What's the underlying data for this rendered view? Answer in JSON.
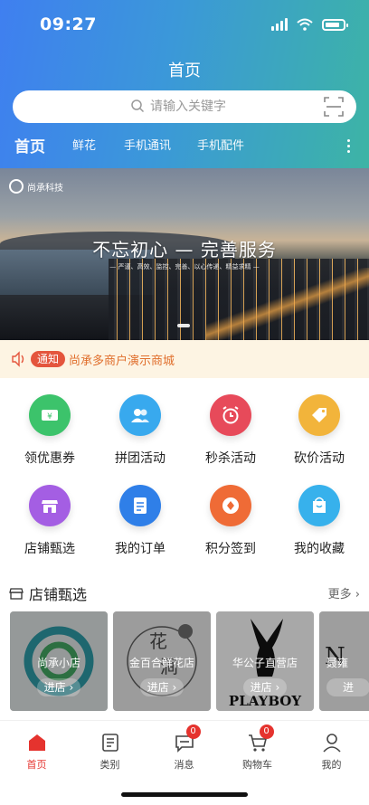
{
  "status_bar": {
    "time": "09:27"
  },
  "header": {
    "title": "首页"
  },
  "search": {
    "placeholder": "请输入关键字",
    "icon": "search-icon",
    "scan_icon": "scan-icon"
  },
  "category_tabs": [
    {
      "label": "首页",
      "active": true
    },
    {
      "label": "鲜花"
    },
    {
      "label": "手机通讯"
    },
    {
      "label": "手机配件"
    }
  ],
  "banner": {
    "logo_text": "尚承科技",
    "headline": "不忘初心 — 完善服务",
    "tagline": "— 严谨、高效、监控、完善、以心传递、精益求精 —"
  },
  "notice": {
    "badge": "通知",
    "text": "尚承多商户演示商城"
  },
  "features": [
    {
      "label": "领优惠券",
      "icon": "coupon-icon",
      "color": "#3cc36b"
    },
    {
      "label": "拼团活动",
      "icon": "group-icon",
      "color": "#38a9ee"
    },
    {
      "label": "秒杀活动",
      "icon": "alarm-clock-icon",
      "color": "#e74a5a"
    },
    {
      "label": "砍价活动",
      "icon": "price-tag-icon",
      "color": "#f2b43b"
    },
    {
      "label": "店铺甄选",
      "icon": "store-icon",
      "color": "#a45ee3"
    },
    {
      "label": "我的订单",
      "icon": "order-icon",
      "color": "#2f7fe8"
    },
    {
      "label": "积分签到",
      "icon": "coin-icon",
      "color": "#ef6b36"
    },
    {
      "label": "我的收藏",
      "icon": "shopping-bag-icon",
      "color": "#37b1ec"
    }
  ],
  "shop_section": {
    "title": "店铺甄选",
    "more": "更多"
  },
  "shops": [
    {
      "name": "尚承小店",
      "enter": "进店"
    },
    {
      "name": "金百合鲜花店",
      "enter": "进店"
    },
    {
      "name": "华公子直营店",
      "enter": "进店",
      "logo_text": "PLAYBOY"
    },
    {
      "name": "聂雍",
      "enter": "进"
    }
  ],
  "tabbar": [
    {
      "label": "首页",
      "icon": "home-icon",
      "active": true
    },
    {
      "label": "类别",
      "icon": "category-icon"
    },
    {
      "label": "消息",
      "icon": "message-icon",
      "badge": "0"
    },
    {
      "label": "购物车",
      "icon": "cart-icon",
      "badge": "0"
    },
    {
      "label": "我的",
      "icon": "profile-icon"
    }
  ],
  "colors": {
    "accent": "#e5332e",
    "header_start": "#3f7ff0",
    "header_end": "#3db4a5",
    "notice_text": "#e06e2c"
  }
}
